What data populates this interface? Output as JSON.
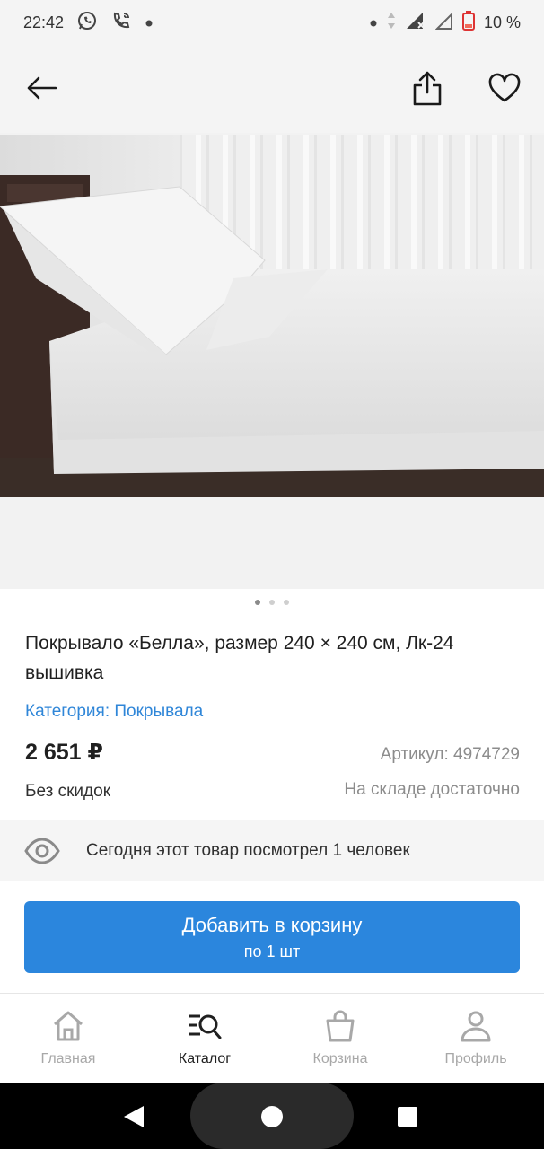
{
  "status_bar": {
    "time": "22:42",
    "battery": "10 %"
  },
  "product": {
    "title": "Покрывало «Белла», размер 240 × 240 см, Лк-24 вышивка",
    "category": "Категория: Покрывала",
    "price": "2 651 ₽",
    "article": "Артикул: 4974729",
    "discount": "Без скидок",
    "stock": "На складе достаточно"
  },
  "gallery": {
    "count": 3,
    "active_index": 0
  },
  "views_notice": "Сегодня этот товар посмотрел 1 человек",
  "cart_button": {
    "label": "Добавить в корзину",
    "sublabel": "по 1 шт"
  },
  "nav": {
    "items": [
      {
        "label": "Главная",
        "icon": "home-icon"
      },
      {
        "label": "Каталог",
        "icon": "catalog-search-icon"
      },
      {
        "label": "Корзина",
        "icon": "bag-icon"
      },
      {
        "label": "Профиль",
        "icon": "profile-icon"
      }
    ],
    "active": "Каталог"
  },
  "colors": {
    "accent": "#2b86dd",
    "link": "#2f86d8",
    "muted": "#8c8c8c"
  }
}
